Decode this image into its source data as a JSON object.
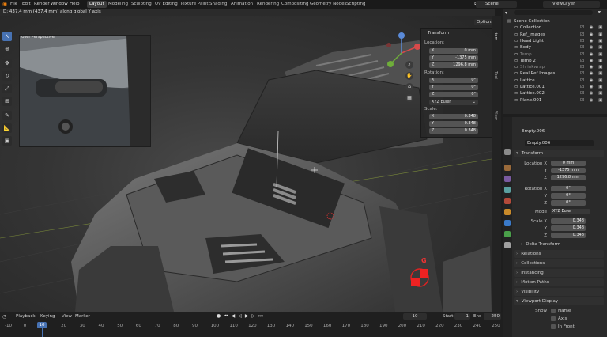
{
  "menubar": {
    "menus": [
      "File",
      "Edit",
      "Render",
      "Window",
      "Help"
    ],
    "workspaces": [
      "Layout",
      "Modeling",
      "Sculpting",
      "UV Editing",
      "Texture Paint",
      "Shading",
      "Animation",
      "Rendering",
      "Compositing",
      "Geometry Nodes",
      "Scripting"
    ],
    "active_workspace": "Layout",
    "scene": "Scene",
    "view_layer": "ViewLayer"
  },
  "viewport": {
    "status": "D: 437.4 mm (437.4 mm) along global Y axis",
    "inset_label": "User Perspective",
    "options_label": "Options",
    "gizmo_label": "G"
  },
  "npanel": {
    "header": "Transform",
    "location_label": "Location:",
    "location": [
      {
        "axis": "X",
        "value": "0 mm"
      },
      {
        "axis": "Y",
        "value": "-1375 mm"
      },
      {
        "axis": "Z",
        "value": "1296.8 mm"
      }
    ],
    "rotation_label": "Rotation:",
    "rotation": [
      {
        "axis": "X",
        "value": "0°"
      },
      {
        "axis": "Y",
        "value": "0°"
      },
      {
        "axis": "Z",
        "value": "0°"
      }
    ],
    "rotation_mode": "XYZ Euler",
    "scale_label": "Scale:",
    "scale": [
      {
        "axis": "X",
        "value": "0.348"
      },
      {
        "axis": "Y",
        "value": "0.348"
      },
      {
        "axis": "Z",
        "value": "0.348"
      }
    ],
    "side_tabs": [
      "Item",
      "Tool",
      "View"
    ]
  },
  "outliner": {
    "items": [
      {
        "name": "Scene Collection",
        "indent": 0
      },
      {
        "name": "Collection",
        "indent": 1
      },
      {
        "name": "Ref_Images",
        "indent": 1
      },
      {
        "name": "Head Light",
        "indent": 1
      },
      {
        "name": "Body",
        "indent": 1
      },
      {
        "name": "Temp",
        "indent": 1,
        "dim": true
      },
      {
        "name": "Temp 2",
        "indent": 1
      },
      {
        "name": "Shrinkwrap",
        "indent": 1,
        "dim": true
      },
      {
        "name": "Real Ref Images",
        "indent": 1
      },
      {
        "name": "Lattice",
        "indent": 1
      },
      {
        "name": "Lattice.001",
        "indent": 1
      },
      {
        "name": "Lattice.002",
        "indent": 1
      },
      {
        "name": "Plane.001",
        "indent": 1
      }
    ]
  },
  "properties": {
    "object_name": "Empty.006",
    "data_name": "Empty.006",
    "transform_header": "Transform",
    "location_x_label": "Location X",
    "location": [
      "0 mm",
      "-1375 mm",
      "1296.8 mm"
    ],
    "rotation_x_label": "Rotation X",
    "rotation": [
      "0°",
      "0°",
      "0°"
    ],
    "mode_label": "Mode",
    "mode": "XYZ Euler",
    "scale_x_label": "Scale X",
    "scale": [
      "0.348",
      "0.348",
      "0.348"
    ],
    "axis_y": "Y",
    "axis_z": "Z",
    "delta": "Delta Transform",
    "sections": [
      "Relations",
      "Collections",
      "Instancing",
      "Motion Paths",
      "Visibility",
      "Viewport Display"
    ],
    "show_label": "Show",
    "show_options": [
      "Name",
      "Axis",
      "In Front"
    ]
  },
  "timeline": {
    "menus": [
      "Playback",
      "Keying",
      "View",
      "Marker"
    ],
    "current_frame": "10",
    "start_label": "Start",
    "start": "1",
    "end_label": "End",
    "end": "250",
    "ticks": [
      "-10",
      "0",
      "10",
      "20",
      "30",
      "40",
      "50",
      "60",
      "70",
      "80",
      "90",
      "100",
      "110",
      "120",
      "130",
      "140",
      "150",
      "160",
      "170",
      "180",
      "190",
      "200",
      "210",
      "220",
      "230",
      "240",
      "250"
    ]
  }
}
